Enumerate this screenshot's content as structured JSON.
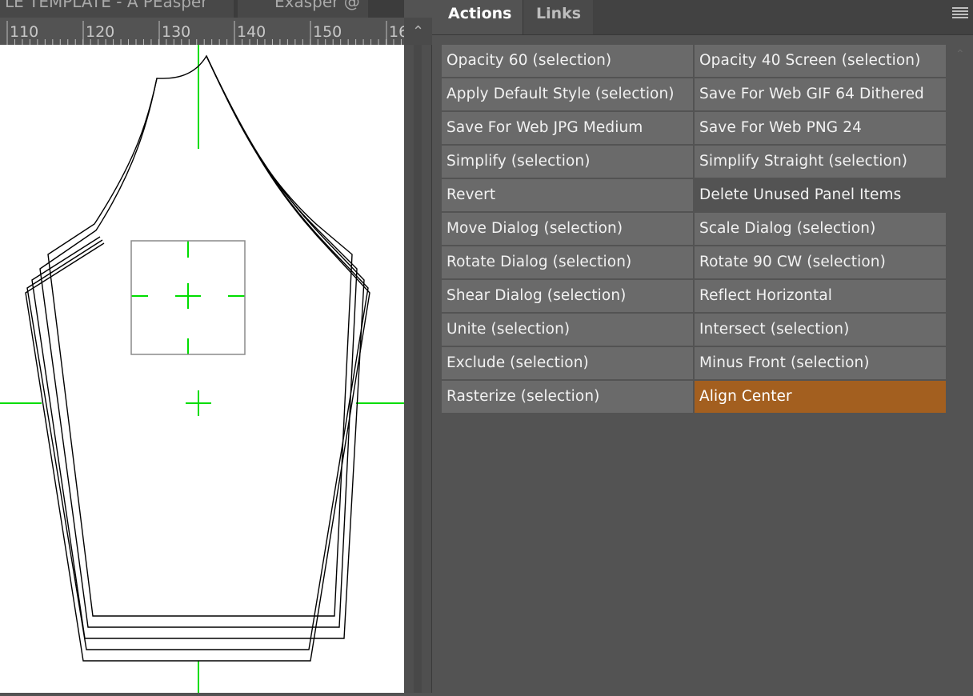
{
  "document": {
    "tabs": [
      "LE TEMPLATE - A PEasper",
      "Exasper @ "
    ],
    "ruler": {
      "ticks": [
        "110",
        "120",
        "130",
        "140",
        "150",
        "16"
      ]
    }
  },
  "panel": {
    "tabs": [
      "Actions",
      "Links"
    ],
    "active_tab": "Actions",
    "menu_icon": "hamburger-menu-icon",
    "actions": [
      {
        "label": "Opacity 60 (selection)",
        "style": "normal"
      },
      {
        "label": "Opacity 40 Screen (selection)",
        "style": "normal"
      },
      {
        "label": "Apply Default Style (selection)",
        "style": "normal"
      },
      {
        "label": "Save For Web GIF 64 Dithered",
        "style": "normal"
      },
      {
        "label": "Save For Web JPG Medium",
        "style": "normal"
      },
      {
        "label": "Save For Web PNG 24",
        "style": "normal"
      },
      {
        "label": "Simplify (selection)",
        "style": "normal"
      },
      {
        "label": "Simplify Straight (selection)",
        "style": "normal"
      },
      {
        "label": "Revert",
        "style": "normal"
      },
      {
        "label": "Delete Unused Panel Items",
        "style": "dark"
      },
      {
        "label": "Move Dialog (selection)",
        "style": "normal"
      },
      {
        "label": "Scale Dialog (selection)",
        "style": "normal"
      },
      {
        "label": "Rotate Dialog (selection)",
        "style": "normal"
      },
      {
        "label": "Rotate 90 CW (selection)",
        "style": "normal"
      },
      {
        "label": "Shear Dialog (selection)",
        "style": "normal"
      },
      {
        "label": "Reflect Horizontal",
        "style": "normal"
      },
      {
        "label": "Unite (selection)",
        "style": "normal"
      },
      {
        "label": "Intersect (selection)",
        "style": "normal"
      },
      {
        "label": "Exclude (selection)",
        "style": "normal"
      },
      {
        "label": "Minus Front (selection)",
        "style": "normal"
      },
      {
        "label": "Rasterize (selection)",
        "style": "normal"
      },
      {
        "label": "Align Center",
        "style": "orange"
      }
    ]
  },
  "colors": {
    "guide": "#00dd00",
    "highlight": "#a35f1f",
    "panel_bg": "#535353",
    "button_bg": "#6a6a6a"
  }
}
